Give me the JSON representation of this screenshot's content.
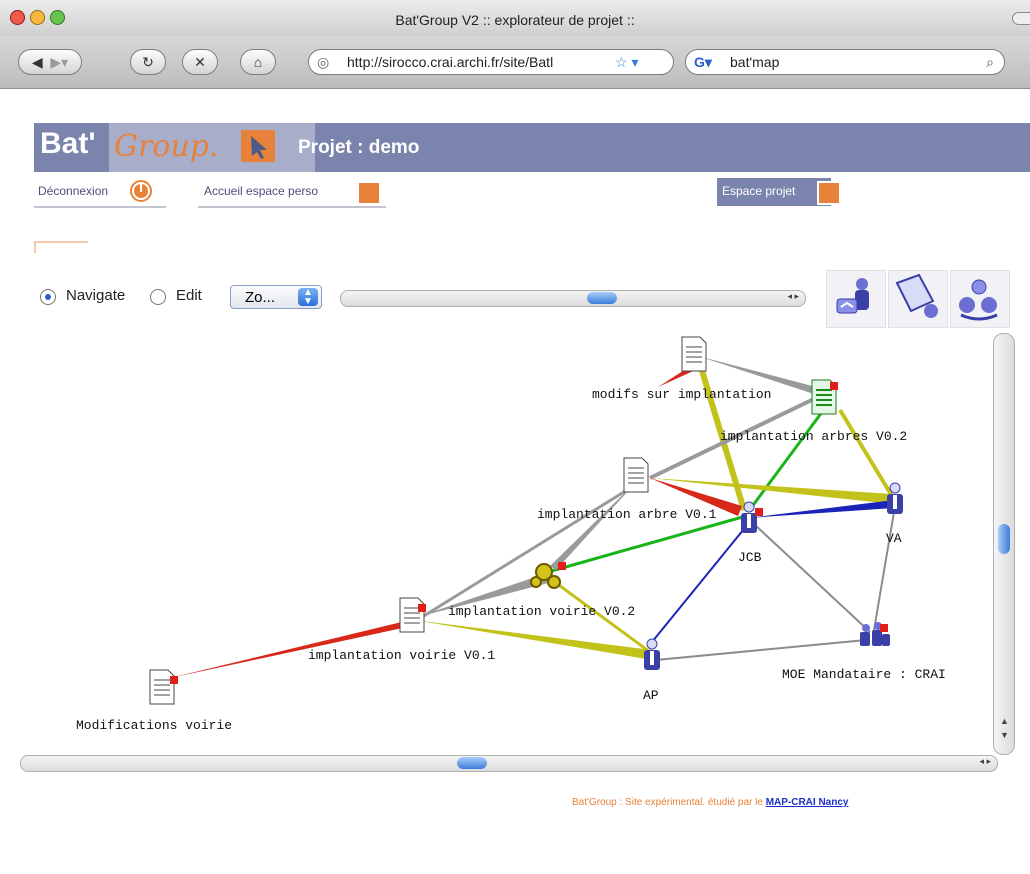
{
  "window": {
    "title": "Bat'Group V2 :: explorateur de projet ::"
  },
  "toolbar": {
    "url": "http://sirocco.crai.archi.fr/site/Batl",
    "search_value": "bat'map"
  },
  "banner": {
    "logo_bat": "Bat'",
    "logo_group": "Group.",
    "project_title": "Projet : demo"
  },
  "nav": {
    "logout": "Déconnexion",
    "home": "Accueil espace perso",
    "project_space": "Espace projet"
  },
  "controls": {
    "navigate_label": "Navigate",
    "edit_label": "Edit",
    "zoom_value": "Zo...",
    "mode": "navigate"
  },
  "graph": {
    "nodes": [
      {
        "id": "modifs",
        "label": "modifs sur implantation",
        "kind": "document"
      },
      {
        "id": "arbres02",
        "label": "implantation arbres V0.2",
        "kind": "document-green"
      },
      {
        "id": "arbre01",
        "label": "implantation arbre V0.1",
        "kind": "document"
      },
      {
        "id": "jcb",
        "label": "JCB",
        "kind": "person"
      },
      {
        "id": "va",
        "label": "VA",
        "kind": "person"
      },
      {
        "id": "voirie02",
        "label": "implantation voirie V0.2",
        "kind": "gears"
      },
      {
        "id": "voirie01",
        "label": "implantation voirie V0.1",
        "kind": "document"
      },
      {
        "id": "ap",
        "label": "AP",
        "kind": "person"
      },
      {
        "id": "moe",
        "label": "MOE Mandataire : CRAI",
        "kind": "group"
      },
      {
        "id": "modifvoirie",
        "label": "Modifications voirie",
        "kind": "document"
      }
    ]
  },
  "footer": {
    "text": "Bat'Group : Site expérimental. étudié par le ",
    "link": "MAP-CRAI Nancy"
  },
  "colors": {
    "banner": "#7b84ad",
    "accent": "#e8823a",
    "red": "#d8281a",
    "olive": "#c2c21a",
    "green": "#19b419",
    "blue": "#1a24b8",
    "gray": "#8c8c8c"
  }
}
